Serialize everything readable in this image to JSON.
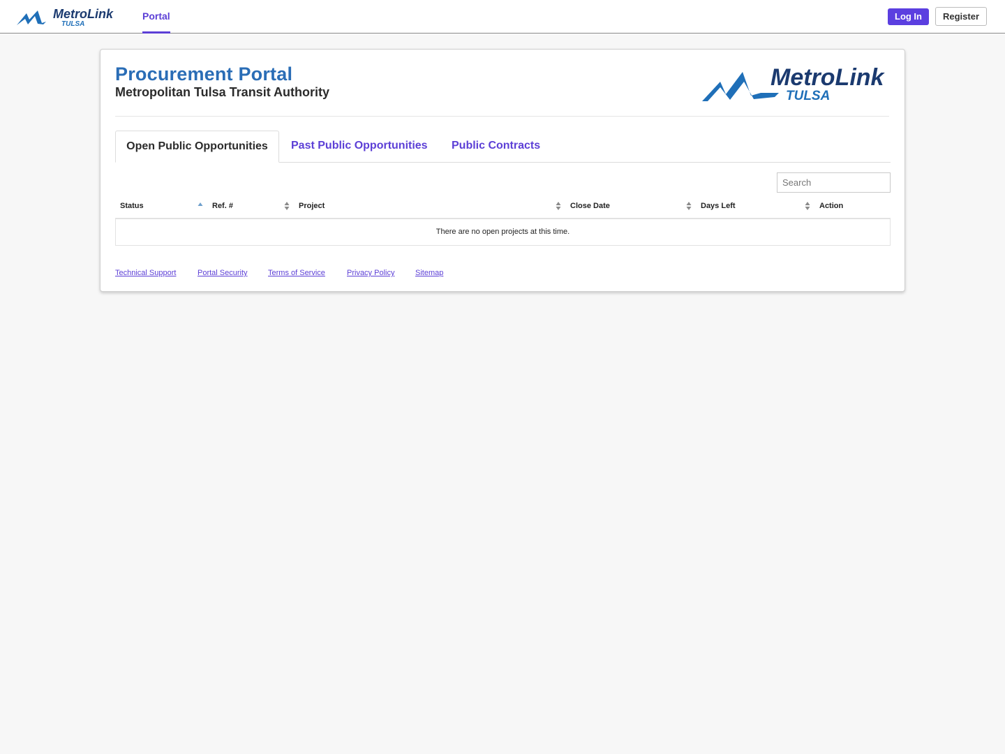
{
  "nav": {
    "logo_wordmark": "MetroLink",
    "logo_subtext": "TULSA",
    "portal_label": "Portal",
    "login_label": "Log In",
    "register_label": "Register"
  },
  "header": {
    "title": "Procurement Portal",
    "subtitle": "Metropolitan Tulsa Transit Authority",
    "logo_wordmark": "MetroLink",
    "logo_subtext": "TULSA"
  },
  "tabs": [
    {
      "label": "Open Public Opportunities",
      "active": true
    },
    {
      "label": "Past Public Opportunities",
      "active": false
    },
    {
      "label": "Public Contracts",
      "active": false
    }
  ],
  "search": {
    "placeholder": "Search",
    "value": ""
  },
  "table": {
    "columns": [
      {
        "label": "Status",
        "sort": "asc"
      },
      {
        "label": "Ref. #",
        "sort": "none"
      },
      {
        "label": "Project",
        "sort": "none"
      },
      {
        "label": "Close Date",
        "sort": "none"
      },
      {
        "label": "Days Left",
        "sort": "none"
      },
      {
        "label": "Action",
        "sort": "none"
      }
    ],
    "empty_message": "There are no open projects at this time."
  },
  "footer": {
    "links": [
      {
        "label": "Technical Support"
      },
      {
        "label": "Portal Security"
      },
      {
        "label": "Terms of Service"
      },
      {
        "label": "Privacy Policy"
      },
      {
        "label": "Sitemap"
      }
    ]
  },
  "colors": {
    "accent": "#5b3fe0",
    "link": "#5c3fd6",
    "title_blue": "#2a6db6",
    "logo_navy": "#1b3a6f",
    "logo_blue": "#1f6fb8",
    "background": "#f7f7f7"
  },
  "icons": {
    "nav_logo": "metrolink-logo-icon",
    "sort_asc": "sort-asc-icon",
    "sort_both": "sort-both-icon"
  }
}
